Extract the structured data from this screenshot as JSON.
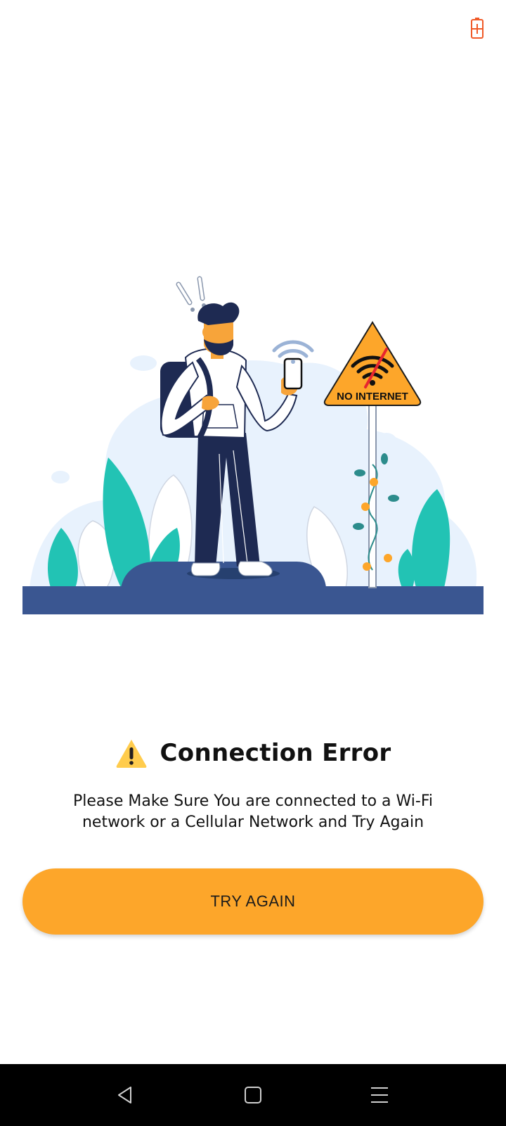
{
  "status_bar": {
    "battery_icon": "battery-charging-icon",
    "battery_color": "#F05A28"
  },
  "illustration": {
    "description_icon": "no-internet-illustration",
    "sign_text": "NO INTERNET"
  },
  "error": {
    "icon": "warning-icon",
    "title": "Connection Error",
    "message": "Please Make Sure You are connected to a Wi-Fi network or a Cellular Network and Try Again"
  },
  "actions": {
    "try_again_label": "TRY AGAIN",
    "button_color": "#FDA62A"
  },
  "navigation_bar": {
    "items": [
      {
        "icon": "back-icon"
      },
      {
        "icon": "home-icon"
      },
      {
        "icon": "menu-icon"
      }
    ]
  }
}
